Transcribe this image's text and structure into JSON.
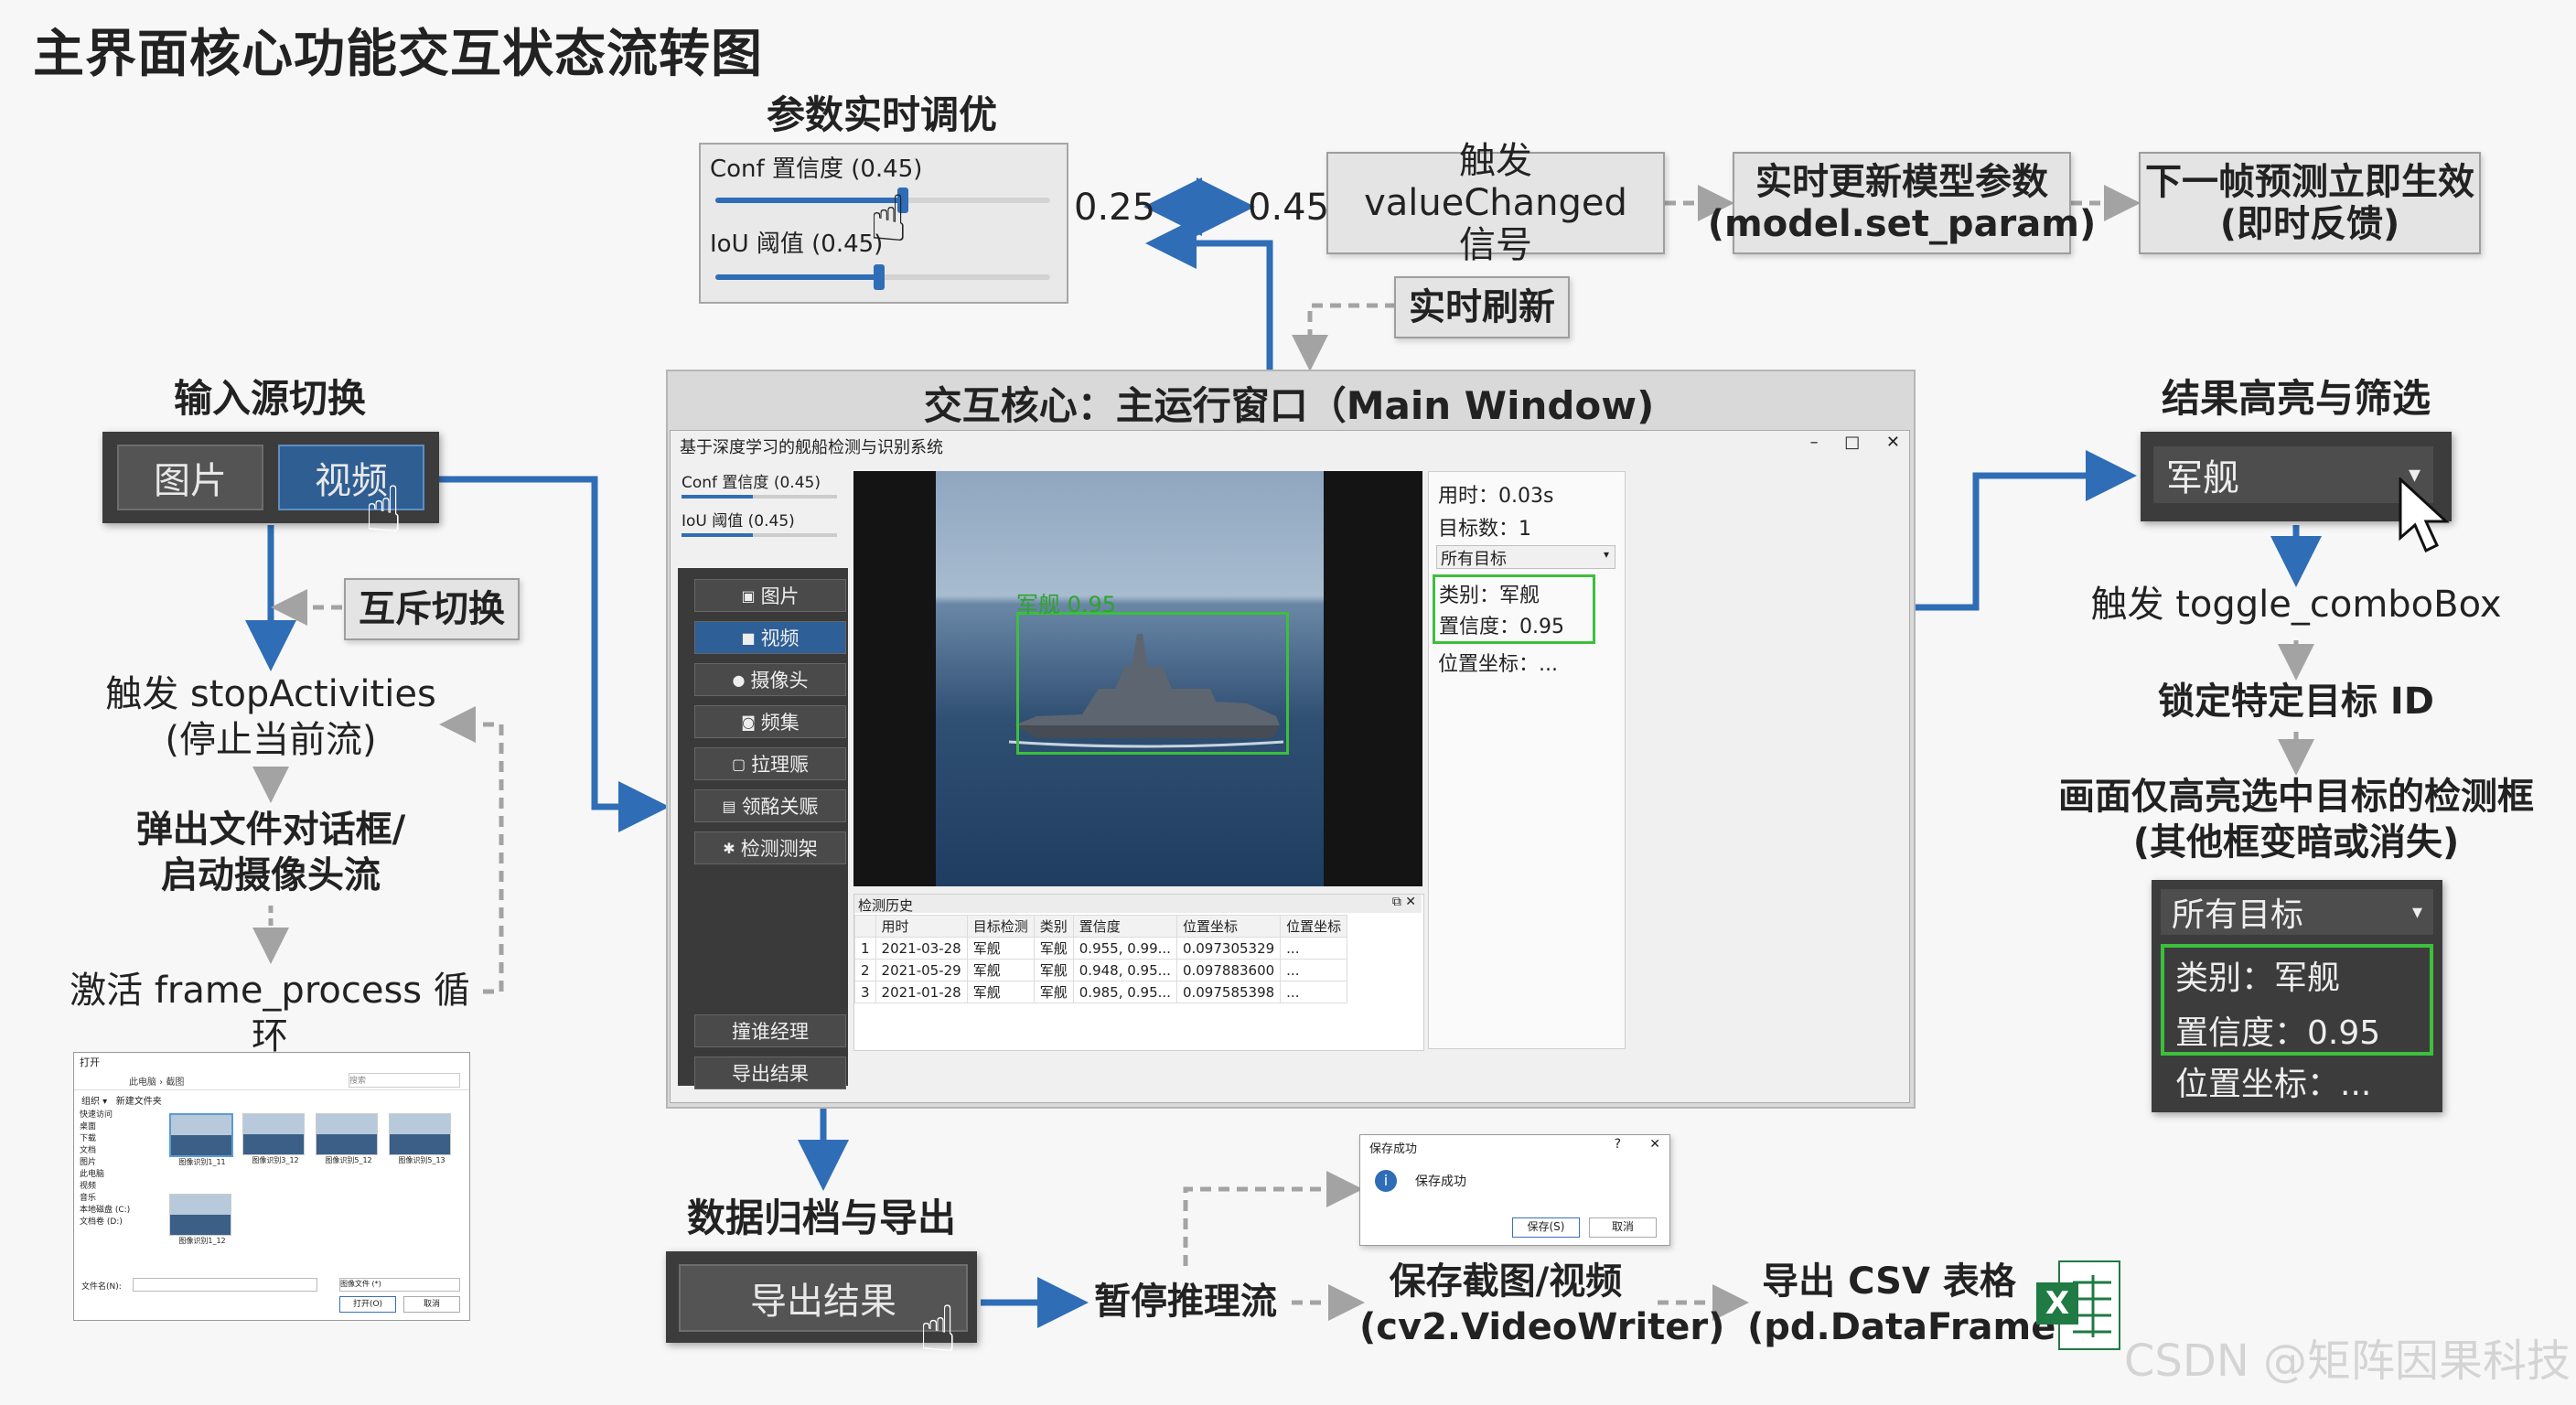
{
  "title": "主界面核心功能交互状态流转图",
  "params": {
    "section_title": "参数实时调优",
    "conf_label": "Conf 置信度 (0.45)",
    "iou_label": "IoU 阈值 (0.45)",
    "conf_value": 0.45,
    "iou_value": 0.45,
    "range_low": "0.25",
    "range_high": "0.45",
    "flow": [
      "触发 valueChanged\n信号",
      "实时更新模型参数\n(model.set_param)",
      "下一帧预测立即生效\n(即时反馈)"
    ],
    "refresh_label": "实时刷新"
  },
  "input": {
    "section_title": "输入源切换",
    "buttons": [
      "图片",
      "视频"
    ],
    "mutex_label": "互斥切换",
    "flow": [
      "触发 stopActivities\n(停止当前流)",
      "弹出文件对话框/\n启动摄像头流",
      "激活 frame_process 循环"
    ]
  },
  "main": {
    "section_title": "交互核心：主运行窗口（Main Window)",
    "window_title": "基于深度学习的舰船检测与识别系统",
    "window_controls": [
      "–",
      "□",
      "✕"
    ],
    "conf_label": "Conf 置信度 (0.45)",
    "iou_label": "IoU 阈值 (0.45)",
    "nav": [
      "图片",
      "视频",
      "摄像头",
      "频集",
      "拉理赈",
      "领酩关赈",
      "检测测架"
    ],
    "nav_icons": [
      "image-icon",
      "video-icon",
      "camera-icon",
      "frames-icon",
      "box-icon",
      "folder-icon",
      "gear-icon"
    ],
    "bottom_nav": [
      "撞谁经理",
      "导出结果"
    ],
    "detection_label": "军舰 0.95",
    "info": {
      "time": "用时：0.03s",
      "count": "目标数：1",
      "filter": "所有目标",
      "class": "类别：军舰",
      "conf": "置信度：0.95",
      "pos": "位置坐标：..."
    },
    "history": {
      "title": "检测历史",
      "headers": [
        "",
        "用时",
        "目标检测",
        "类别",
        "置信度",
        "位置坐标",
        "位置坐标"
      ],
      "rows": [
        [
          "1",
          "2021-03-28",
          "军舰",
          "军舰",
          "0.955, 0.99...",
          "0.097305329",
          "..."
        ],
        [
          "2",
          "2021-05-29",
          "军舰",
          "军舰",
          "0.948, 0.95...",
          "0.097883600",
          "..."
        ],
        [
          "3",
          "2021-01-28",
          "军舰",
          "军舰",
          "0.985, 0.95...",
          "0.097585398",
          "..."
        ]
      ]
    }
  },
  "filter": {
    "section_title": "结果高亮与筛选",
    "combo_value": "军舰",
    "flow": [
      "触发 toggle_comboBox",
      "锁定特定目标 ID",
      "画面仅高亮选中目标的检测框\n(其他框变暗或消失)"
    ],
    "panel": {
      "combo": "所有目标",
      "class": "类别：军舰",
      "conf": "置信度：0.95",
      "pos": "位置坐标：..."
    }
  },
  "export": {
    "section_title": "数据归档与导出",
    "button": "导出结果",
    "flow": [
      "暂停推理流",
      "保存截图/视频\n(cv2.VideoWriter)",
      "导出 CSV 表格\n(pd.DataFrame)"
    ],
    "dialog": {
      "title": "保存成功",
      "message": "保存成功",
      "buttons": [
        "保存(S)",
        "取消"
      ],
      "controls": [
        "?",
        "✕"
      ]
    },
    "excel_letter": "X"
  },
  "file_dialog": {
    "title": "打开",
    "crumb": "此电脑 › 截图",
    "search": "搜索",
    "toolbar": [
      "组织 ▾",
      "新建文件夹"
    ],
    "tree": [
      "快速访问",
      "桌面",
      "下载",
      "文档",
      "图片",
      "此电脑",
      "视频",
      "音乐",
      "本地磁盘 (C:)",
      "文档卷 (D:)"
    ],
    "files": [
      "图像识别1_11",
      "图像识别3_12",
      "图像识别5_12",
      "图像识别5_13",
      "图像识别1_12"
    ],
    "filename_label": "文件名(N):",
    "filter": "图像文件 (*)",
    "buttons": [
      "打开(O)",
      "取消"
    ]
  },
  "watermark": "CSDN @矩阵因果科技",
  "colors": {
    "accent": "#2f6db6",
    "dark_panel": "#3c3c3c",
    "highlight_green": "#3cbf3c",
    "excel_green": "#1f7a43"
  }
}
